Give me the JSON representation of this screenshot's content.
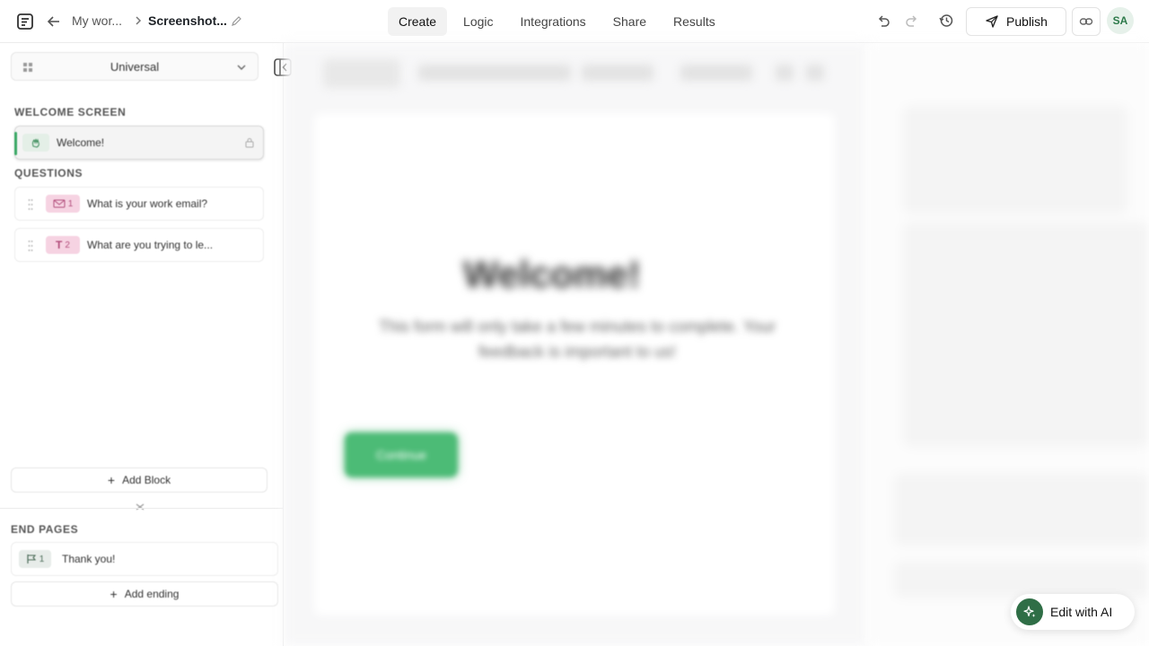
{
  "header": {
    "breadcrumb_workspace": "My wor...",
    "breadcrumb_form": "Screenshot...",
    "tabs": [
      {
        "label": "Create",
        "active": true
      },
      {
        "label": "Logic",
        "active": false
      },
      {
        "label": "Integrations",
        "active": false
      },
      {
        "label": "Share",
        "active": false
      },
      {
        "label": "Results",
        "active": false
      }
    ],
    "publish_label": "Publish",
    "avatar_initials": "SA"
  },
  "sidebar": {
    "language_selected": "Universal",
    "welcome_section": "WELCOME SCREEN",
    "welcome_item": "Welcome!",
    "questions_section": "QUESTIONS",
    "questions": [
      {
        "label": "What is your work email?",
        "number": "1",
        "icon": "email-icon",
        "chip_color": "#f6d3e2"
      },
      {
        "label": "What are you trying to le...",
        "number": "2",
        "icon": "text-icon",
        "chip_color": "#f6d3e2"
      }
    ],
    "add_block_label": "Add Block",
    "end_section": "END PAGES",
    "end_item": "Thank you!",
    "end_item_number": "1",
    "add_ending_label": "Add ending"
  },
  "canvas": {
    "welcome_title": "Welcome!",
    "welcome_subtitle": "This form will only take a few minutes to complete. Your feedback is important to us!",
    "button_label": "Continue"
  },
  "ai_button": {
    "label": "Edit with AI"
  },
  "colors": {
    "accent_green": "#3aa865",
    "button_green": "#4cbb76",
    "ai_dark_green": "#2f6e46",
    "question_chip_pink": "#f6d3e2"
  }
}
